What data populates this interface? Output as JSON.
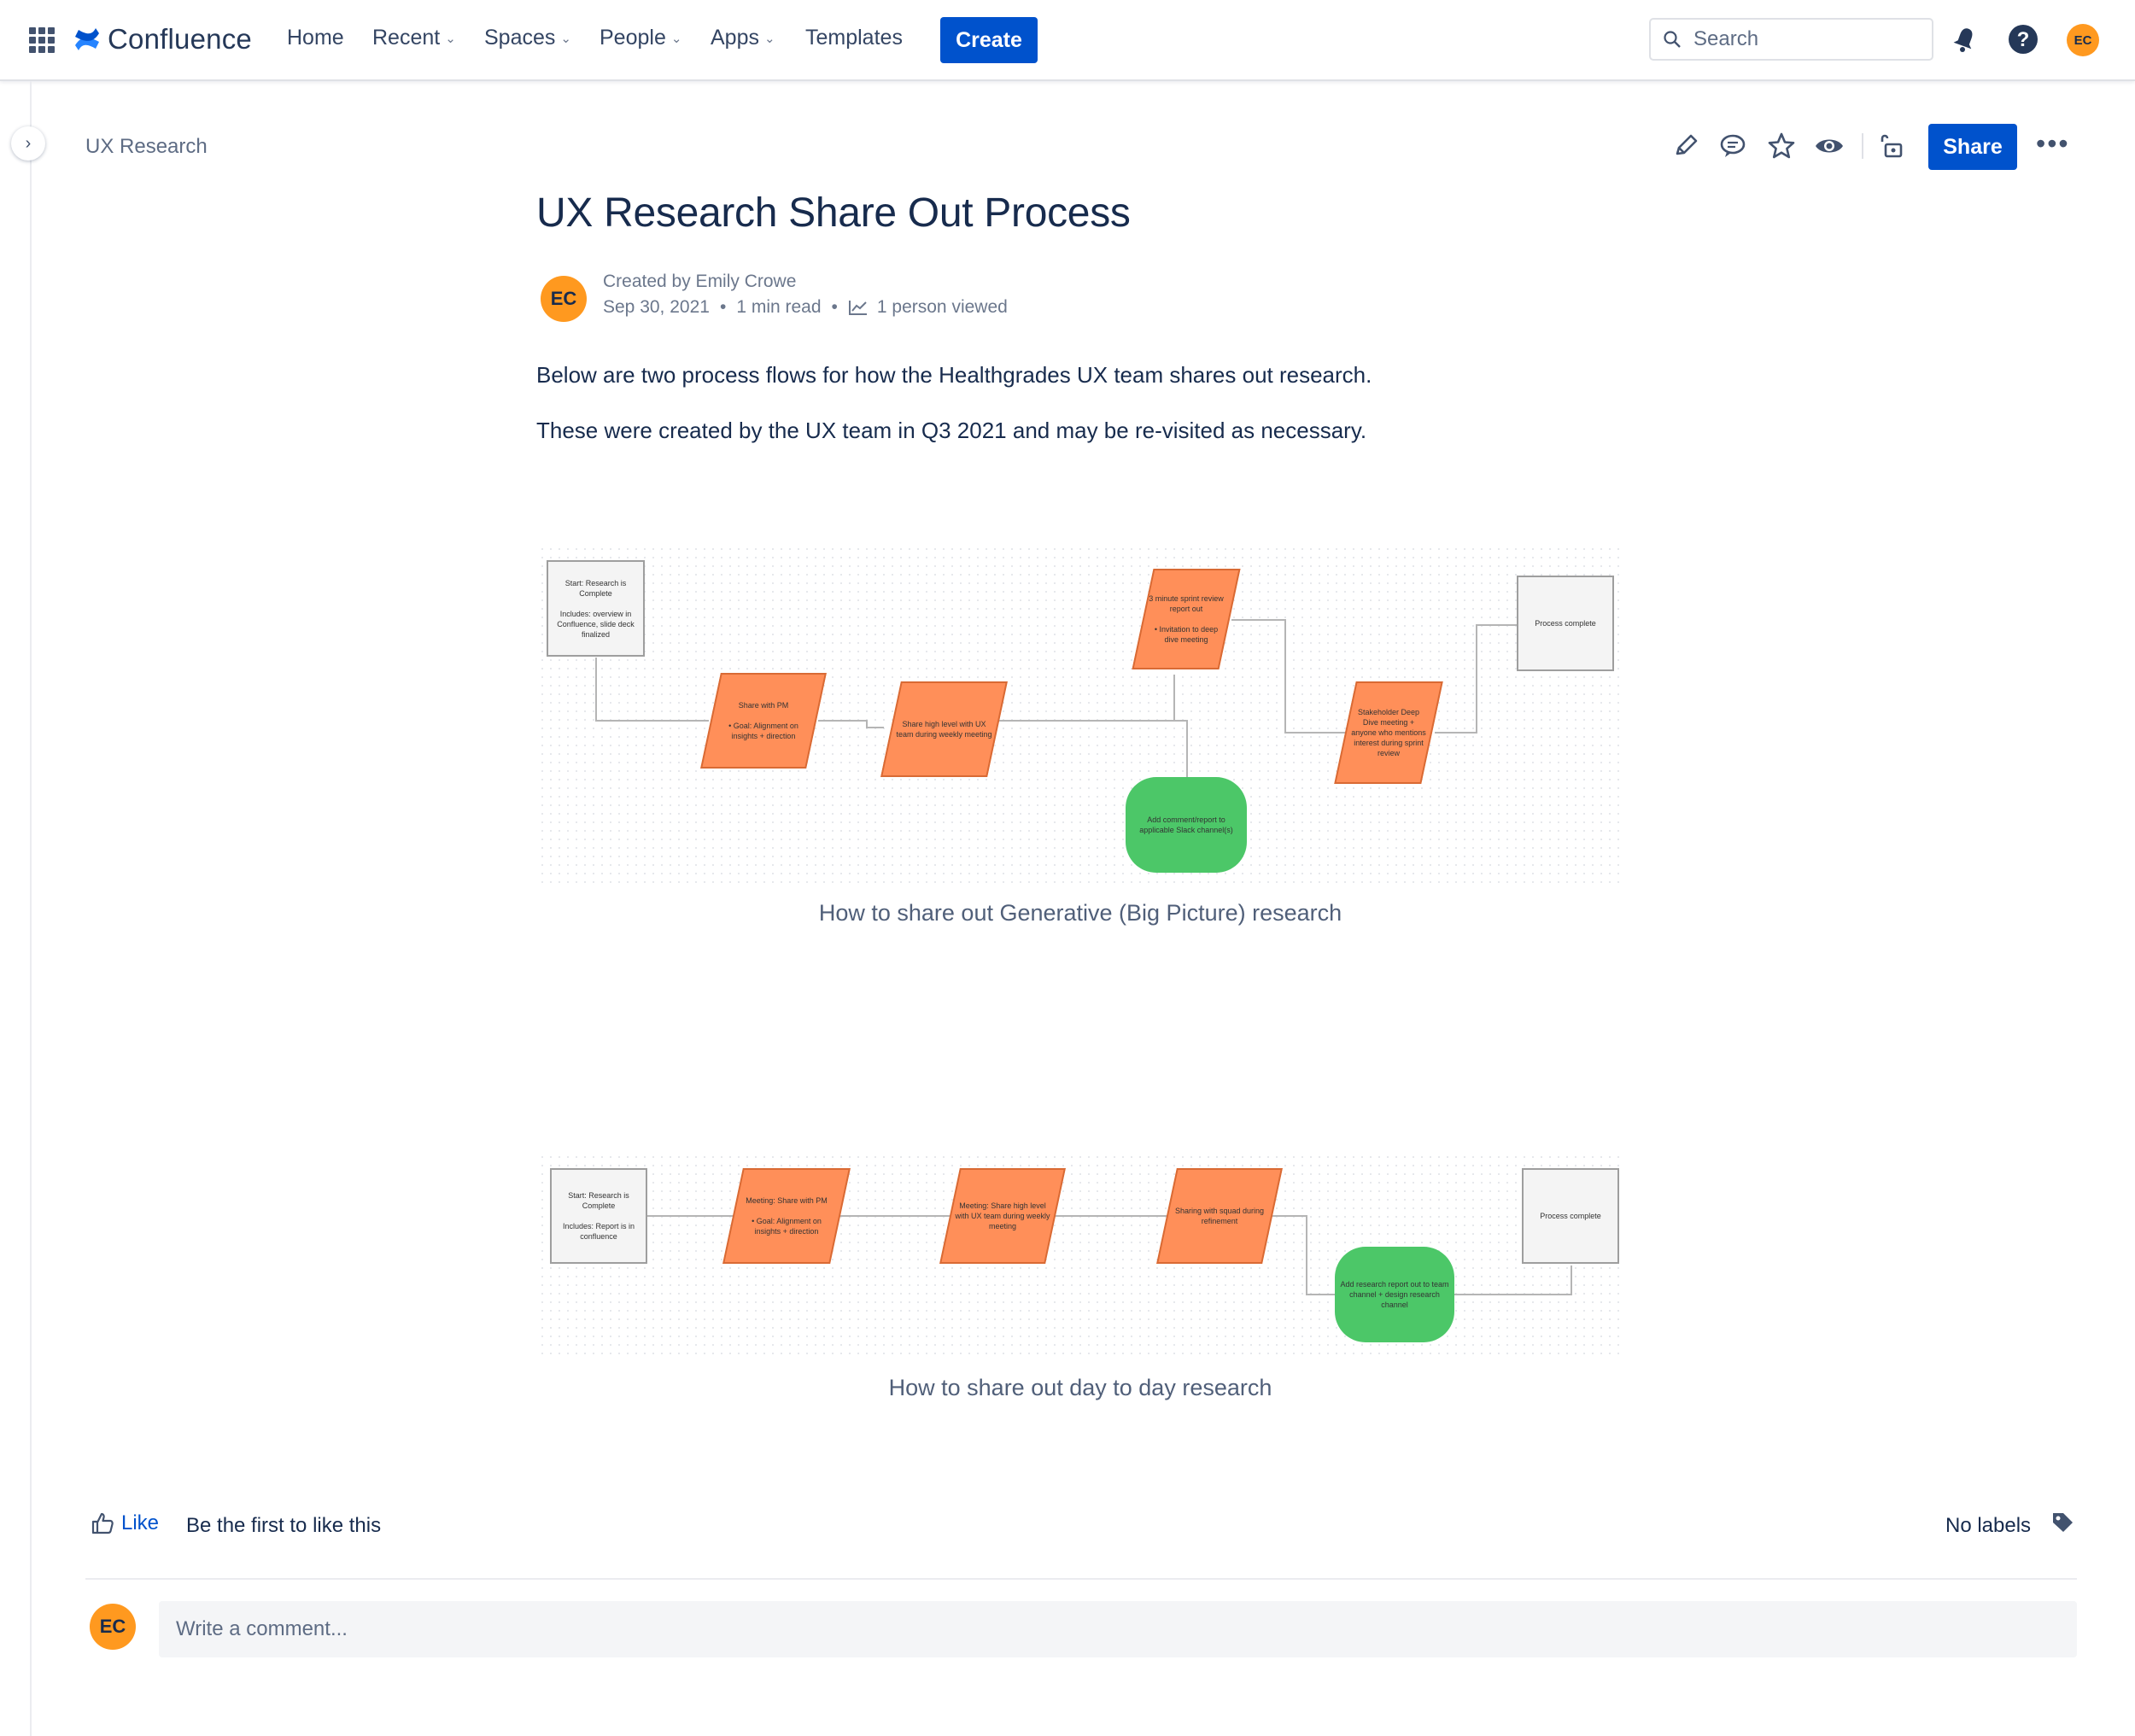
{
  "app": {
    "name": "Confluence"
  },
  "nav": {
    "items": [
      {
        "label": "Home",
        "dropdown": false
      },
      {
        "label": "Recent",
        "dropdown": true
      },
      {
        "label": "Spaces",
        "dropdown": true
      },
      {
        "label": "People",
        "dropdown": true
      },
      {
        "label": "Apps",
        "dropdown": true
      },
      {
        "label": "Templates",
        "dropdown": false
      }
    ],
    "create_label": "Create"
  },
  "search": {
    "placeholder": "Search"
  },
  "user": {
    "initials": "EC",
    "avatar_color": "#FF991F"
  },
  "breadcrumb": {
    "space": "UX Research"
  },
  "page_toolbar": {
    "icons": [
      "edit-icon",
      "comment-icon",
      "star-icon",
      "watch-icon",
      "restrictions-icon"
    ],
    "share_label": "Share",
    "more_label": "•••"
  },
  "page": {
    "title": "UX Research Share Out Process",
    "byline": {
      "created_by": "Created by Emily Crowe",
      "date": "Sep 30, 2021",
      "read_time": "1 min read",
      "views": "1 person viewed"
    },
    "paragraphs": [
      "Below are two process flows for how the Healthgrades UX team shares out research.",
      "These were created by the UX team in Q3 2021 and may be re-visited as necessary."
    ]
  },
  "diagrams": [
    {
      "caption": "How to share out Generative (Big Picture) research",
      "nodes": [
        {
          "id": "start",
          "shape": "grey",
          "text": "Start: Research is Complete\n\nIncludes: overview in Confluence, slide deck finalized"
        },
        {
          "id": "pm",
          "shape": "orange",
          "text": "Share with PM\n\n• Goal: Alignment on insights + direction"
        },
        {
          "id": "weekly",
          "shape": "orange",
          "text": "Share high level with UX team during weekly meeting"
        },
        {
          "id": "sprint",
          "shape": "orange",
          "text": "3 minute sprint review report out\n\n• Invitation to deep dive meeting"
        },
        {
          "id": "slack",
          "shape": "green",
          "text": "Add comment/report to applicable Slack channel(s)"
        },
        {
          "id": "deepdive",
          "shape": "orange",
          "text": "Stakeholder Deep Dive meeting + anyone who mentions interest during sprint review"
        },
        {
          "id": "done",
          "shape": "grey",
          "text": "Process complete"
        }
      ]
    },
    {
      "caption": "How to share out day to day research",
      "nodes": [
        {
          "id": "start",
          "shape": "grey",
          "text": "Start: Research is Complete\n\nIncludes: Report is in confluence"
        },
        {
          "id": "pm",
          "shape": "orange",
          "text": "Meeting: Share with PM\n\n• Goal: Alignment on insights + direction"
        },
        {
          "id": "weekly",
          "shape": "orange",
          "text": "Meeting: Share high level with UX team during weekly meeting"
        },
        {
          "id": "squad",
          "shape": "orange",
          "text": "Sharing with squad during refinement"
        },
        {
          "id": "channel",
          "shape": "green",
          "text": "Add research report out to team channel + design research channel"
        },
        {
          "id": "done",
          "shape": "grey",
          "text": "Process complete"
        }
      ]
    }
  ],
  "footer": {
    "like_label": "Like",
    "like_prompt": "Be the first to like this",
    "labels_text": "No labels",
    "comment_placeholder": "Write a comment..."
  },
  "colors": {
    "primary": "#0052CC",
    "orange_node": "#FF8F59",
    "green_node": "#4CC768",
    "grey_node": "#F4F4F4"
  }
}
